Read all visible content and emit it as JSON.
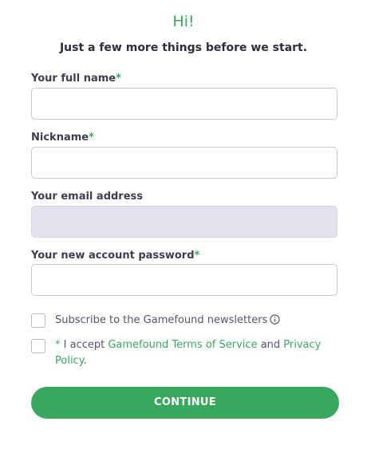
{
  "header": {
    "greeting": "Hi!",
    "subtitle": "Just a few more things before we start."
  },
  "form": {
    "full_name": {
      "label": "Your full name",
      "required_mark": "*",
      "value": ""
    },
    "nickname": {
      "label": "Nickname",
      "required_mark": "*",
      "value": ""
    },
    "email": {
      "label": "Your email address",
      "value": ""
    },
    "password": {
      "label": "Your new account password",
      "required_mark": "*",
      "value": ""
    }
  },
  "checkboxes": {
    "newsletter": {
      "label": "Subscribe to the Gamefound newsletters",
      "checked": false,
      "icon": "info-icon"
    },
    "terms": {
      "required_mark": "*",
      "text_before": " I accept ",
      "terms_link": "Gamefound Terms of Service",
      "text_middle": " and ",
      "privacy_link": "Privacy Policy",
      "text_after": ".",
      "checked": false
    }
  },
  "actions": {
    "continue_label": "CONTINUE"
  },
  "colors": {
    "accent": "#3aa75e",
    "disabled_field": "#e2e2ec",
    "text": "#3e3e50"
  }
}
